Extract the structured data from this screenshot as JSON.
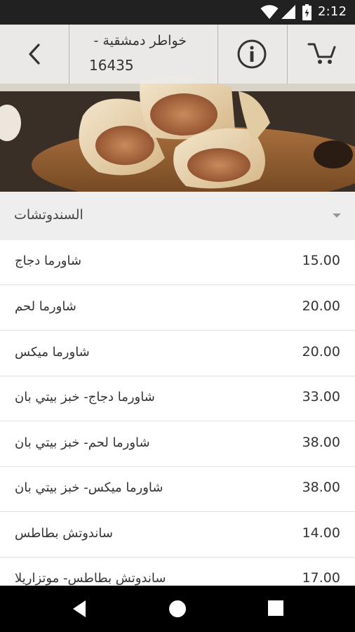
{
  "status_bar": {
    "time": "2:12",
    "icons": [
      "wifi-icon",
      "signal-icon",
      "battery-icon"
    ]
  },
  "header": {
    "title_line1": "خواطر دمشقية -",
    "title_line2": "16435",
    "back_icon": "chevron-left-icon",
    "info_icon": "info-icon",
    "cart_icon": "cart-icon"
  },
  "section": {
    "title": "السندوتشات",
    "caret_icon": "caret-down-icon"
  },
  "menu_items": [
    {
      "name": "شاورما دجاج",
      "price": "15.00"
    },
    {
      "name": "شاورما لحم",
      "price": "20.00"
    },
    {
      "name": "شاورما ميكس",
      "price": "20.00"
    },
    {
      "name": "شاورما دجاج- خبز بيتي بان",
      "price": "33.00"
    },
    {
      "name": "شاورما لحم- خبز بيتي بان",
      "price": "38.00"
    },
    {
      "name": "شاورما ميكس- خبز بيتي بان",
      "price": "38.00"
    },
    {
      "name": "ساندوتش بطاطس",
      "price": "14.00"
    },
    {
      "name": "ساندوتش بطاطس- موتزاريلا",
      "price": "17.00"
    }
  ],
  "nav_bar": {
    "icons": [
      "back-triangle-icon",
      "home-circle-icon",
      "recents-square-icon"
    ]
  },
  "colors": {
    "status_bar": "#212121",
    "section_bg": "#eeeeee",
    "header_overlay": "#ececec",
    "text": "#333333"
  }
}
